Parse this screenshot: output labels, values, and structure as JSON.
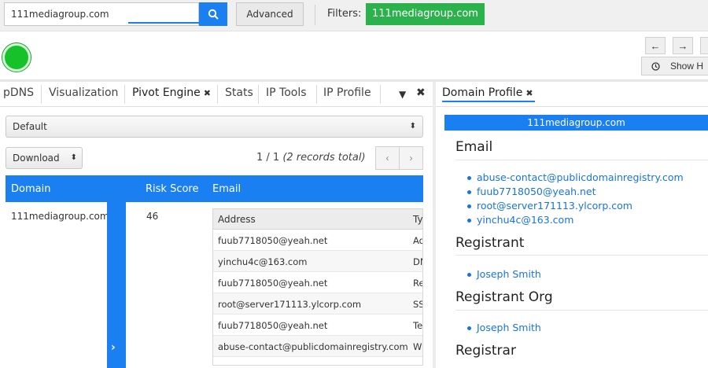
{
  "search": {
    "value": "111mediagroup.com"
  },
  "toolbar": {
    "advanced_label": "Advanced",
    "filters_label": "Filters:",
    "filter_chip": "111mediagroup.com"
  },
  "nav": {
    "back": "←",
    "forward": "→",
    "show_label": "Show H"
  },
  "left_tabs": [
    {
      "label": "pDNS"
    },
    {
      "label": "Visualization"
    },
    {
      "label": "Pivot Engine",
      "active": true
    },
    {
      "label": "Stats"
    },
    {
      "label": "IP Tools"
    },
    {
      "label": "IP Profile"
    }
  ],
  "right_tab": {
    "label": "Domain Profile"
  },
  "pivot": {
    "view_select": "Default",
    "download_select": "Download",
    "records_page": "1 / 1",
    "records_total": "(2 records total)",
    "columns": {
      "domain": "Domain",
      "risk": "Risk Score",
      "email": "Email"
    },
    "row": {
      "domain": "111mediagroup.com",
      "risk": "46"
    },
    "email_table": {
      "headers": {
        "address": "Address",
        "type": "Ty"
      },
      "rows": [
        {
          "address": "fuub7718050@yeah.net",
          "type": "Ad"
        },
        {
          "address": "yinchu4c@163.com",
          "type": "DN"
        },
        {
          "address": "fuub7718050@yeah.net",
          "type": "Re"
        },
        {
          "address": "root@server171113.ylcorp.com",
          "type": "SS"
        },
        {
          "address": "fuub7718050@yeah.net",
          "type": "Te"
        },
        {
          "address": "abuse-contact@publicdomainregistry.com",
          "type": "WI"
        }
      ]
    }
  },
  "profile": {
    "domain": "111mediagroup.com",
    "email_heading": "Email",
    "emails": [
      "abuse-contact@publicdomainregistry.com",
      "fuub7718050@yeah.net",
      "root@server171113.ylcorp.com",
      "yinchu4c@163.com"
    ],
    "registrant_heading": "Registrant",
    "registrant": "Joseph Smith",
    "registrant_org_heading": "Registrant Org",
    "registrant_org": "Joseph Smith",
    "registrar_heading": "Registrar"
  },
  "colors": {
    "accent": "#1a7ff0",
    "filter_chip": "#2bb24c",
    "status": "#16c229"
  }
}
